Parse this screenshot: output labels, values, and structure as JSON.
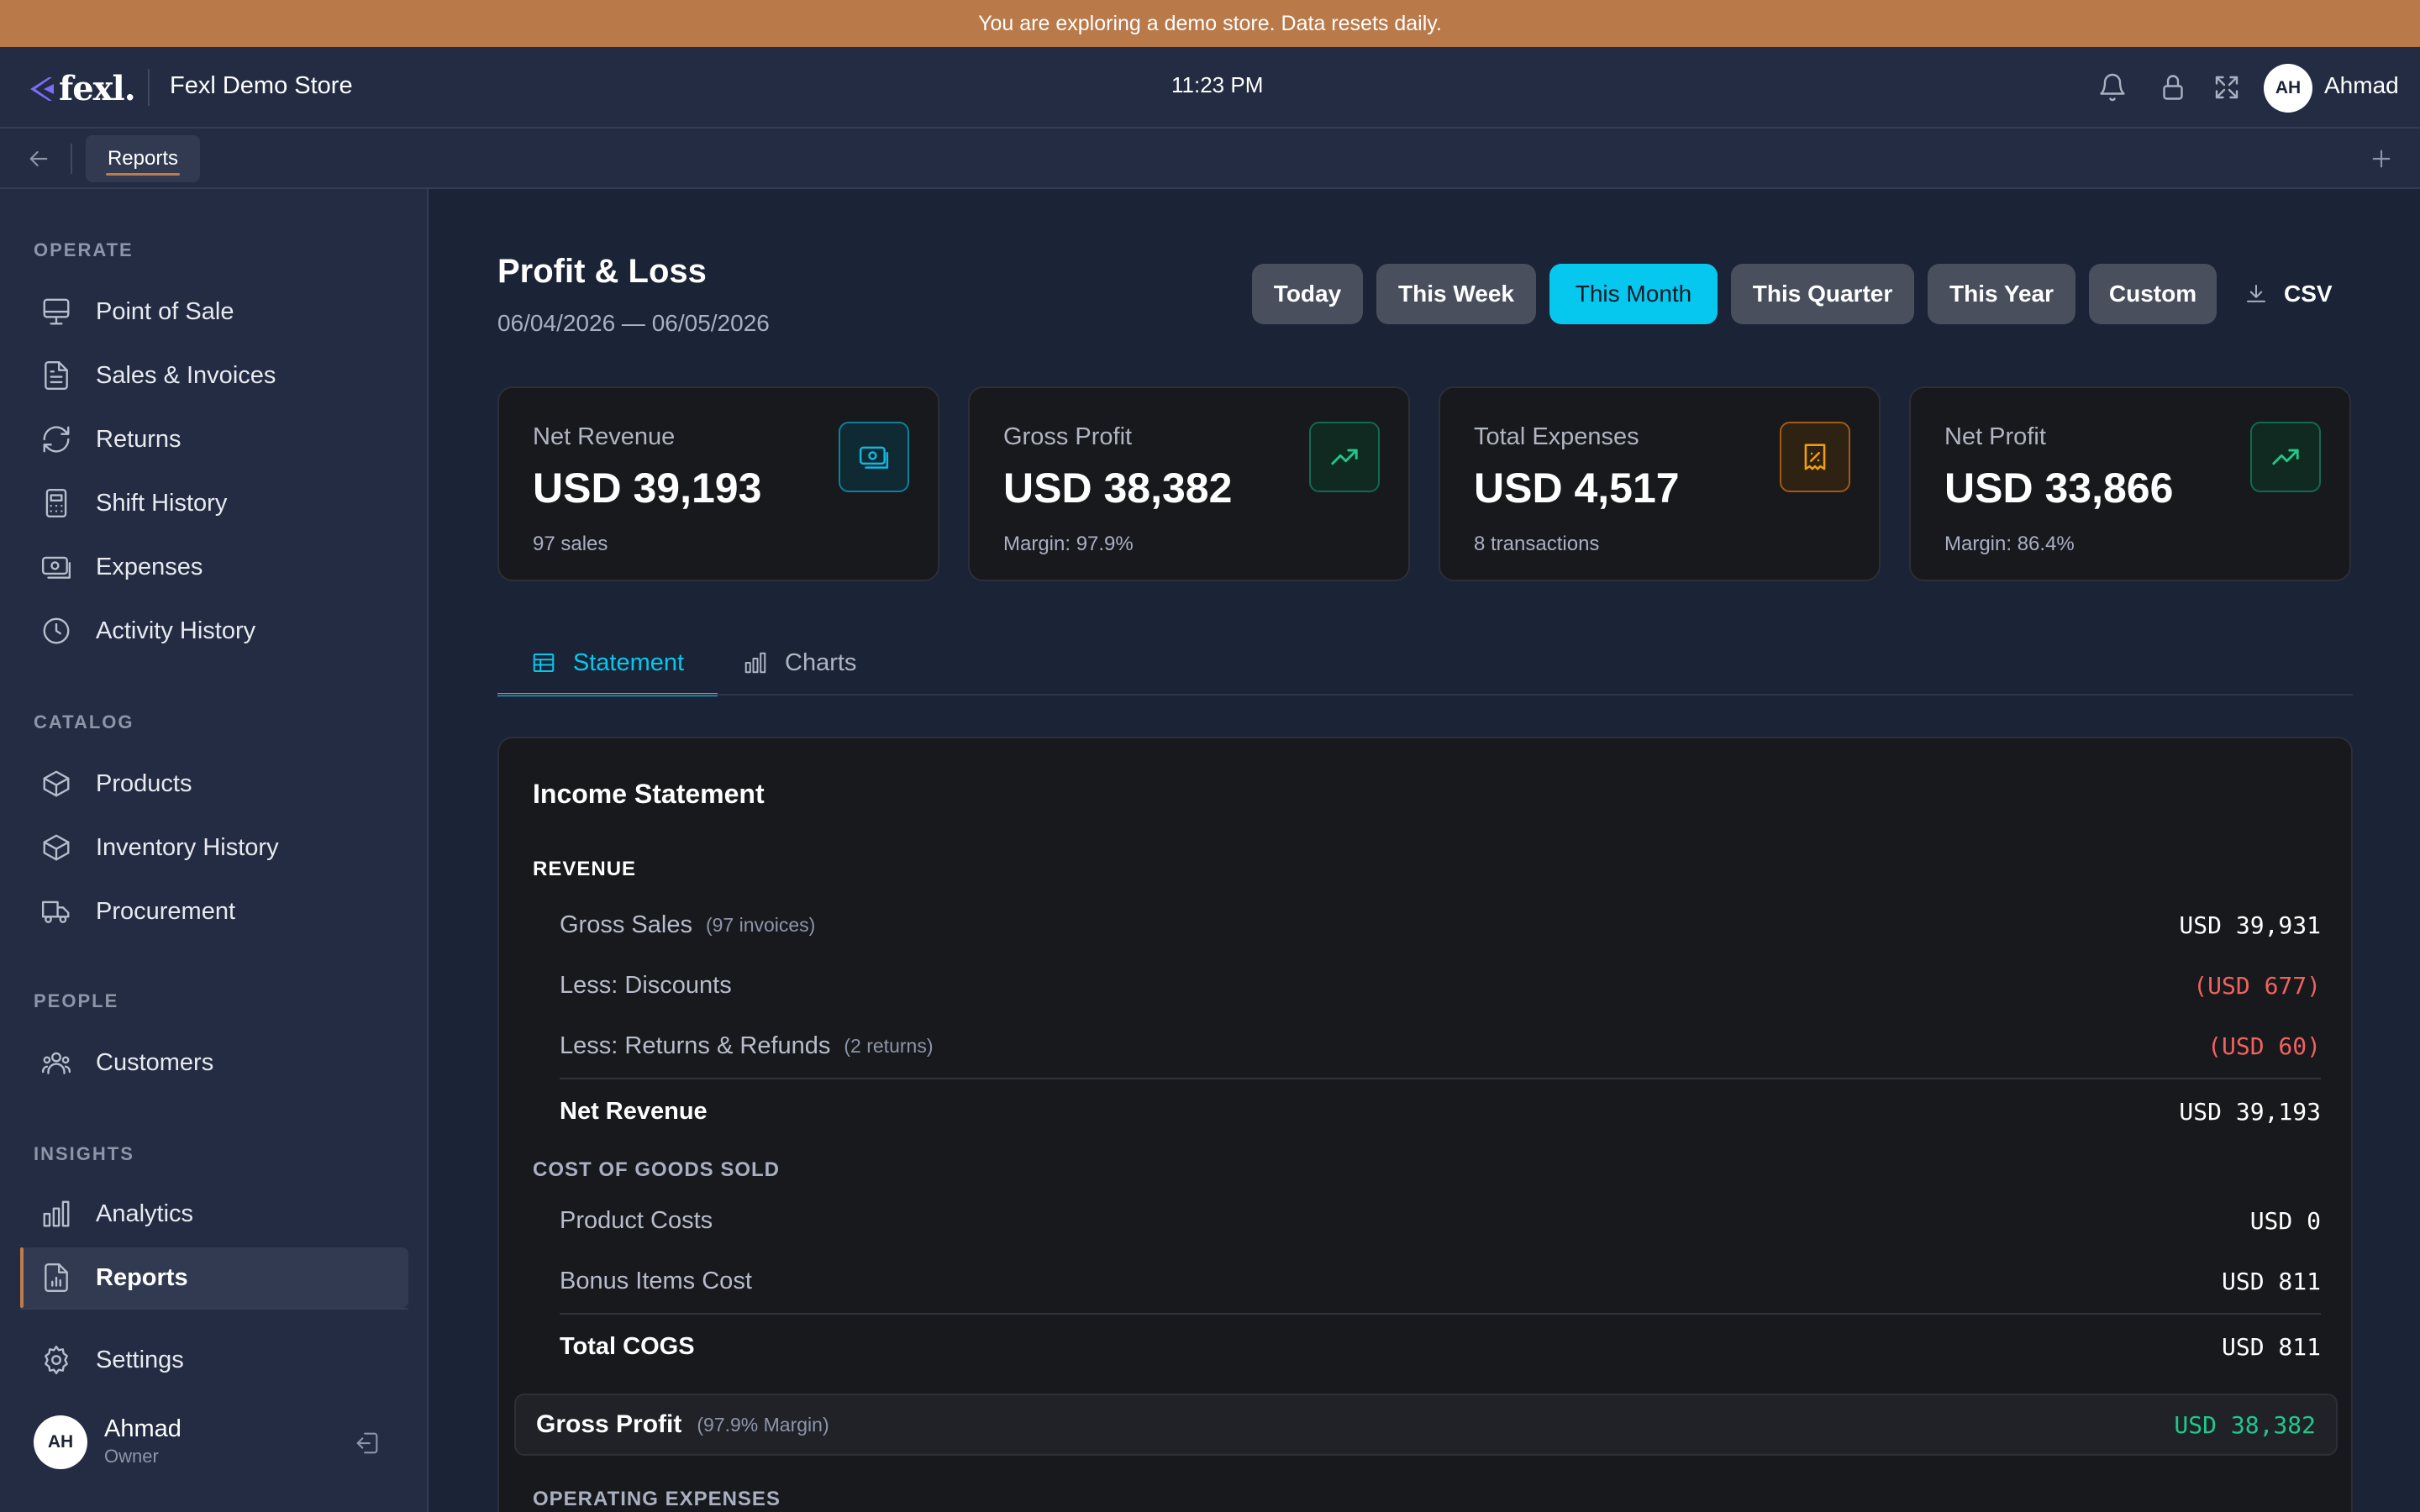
{
  "banner": {
    "text": "You are exploring a demo store. Data resets daily."
  },
  "header": {
    "logo_text": "fexl.",
    "store_name": "Fexl Demo Store",
    "time": "11:23 PM",
    "user_initials": "AH",
    "user_name": "Ahmad",
    "icons": [
      "bell-icon",
      "lock-icon",
      "fullscreen-icon"
    ]
  },
  "tabstrip": {
    "active_tab": "Reports"
  },
  "sidebar": {
    "sections": [
      {
        "label": "OPERATE",
        "items": [
          {
            "label": "Point of Sale",
            "icon": "monitor-icon"
          },
          {
            "label": "Sales & Invoices",
            "icon": "document-icon"
          },
          {
            "label": "Returns",
            "icon": "refresh-icon"
          },
          {
            "label": "Shift History",
            "icon": "calculator-icon"
          },
          {
            "label": "Expenses",
            "icon": "banknote-icon"
          },
          {
            "label": "Activity History",
            "icon": "clock-icon"
          }
        ]
      },
      {
        "label": "CATALOG",
        "items": [
          {
            "label": "Products",
            "icon": "box-icon"
          },
          {
            "label": "Inventory History",
            "icon": "box-icon"
          },
          {
            "label": "Procurement",
            "icon": "truck-icon"
          }
        ]
      },
      {
        "label": "PEOPLE",
        "items": [
          {
            "label": "Customers",
            "icon": "users-icon"
          }
        ]
      },
      {
        "label": "INSIGHTS",
        "items": [
          {
            "label": "Analytics",
            "icon": "bar-chart-icon"
          },
          {
            "label": "Reports",
            "icon": "report-icon",
            "active": true
          }
        ]
      }
    ],
    "settings_label": "Settings",
    "user": {
      "initials": "AH",
      "name": "Ahmad",
      "role": "Owner"
    }
  },
  "page": {
    "title": "Profit & Loss",
    "date_range": "06/04/2026 — 06/05/2026",
    "periods": [
      "Today",
      "This Week",
      "This Month",
      "This Quarter",
      "This Year",
      "Custom"
    ],
    "active_period": "This Month",
    "csv_label": "CSV"
  },
  "cards": [
    {
      "label": "Net Revenue",
      "value": "USD 39,193",
      "sub": "97 sales",
      "icon": "banknote-icon",
      "accent": "#0ea5c9"
    },
    {
      "label": "Gross Profit",
      "value": "USD 38,382",
      "sub": "Margin: 97.9%",
      "icon": "trending-up-icon",
      "accent": "#10b981"
    },
    {
      "label": "Total Expenses",
      "value": "USD 4,517",
      "sub": "8 transactions",
      "icon": "receipt-icon",
      "accent": "#f59e0b"
    },
    {
      "label": "Net Profit",
      "value": "USD 33,866",
      "sub": "Margin: 86.4%",
      "icon": "trending-up-icon",
      "accent": "#10b981"
    }
  ],
  "view_tabs": [
    {
      "label": "Statement",
      "icon": "table-icon",
      "active": true
    },
    {
      "label": "Charts",
      "icon": "bar-chart-icon",
      "active": false
    }
  ],
  "statement": {
    "title": "Income Statement",
    "revenue": {
      "heading": "REVENUE",
      "rows": [
        {
          "label": "Gross Sales",
          "note": "(97 invoices)",
          "value": "USD 39,931"
        },
        {
          "label": "Less: Discounts",
          "note": "",
          "value": "(USD 677)"
        },
        {
          "label": "Less: Returns & Refunds",
          "note": "(2 returns)",
          "value": "(USD 60)"
        }
      ],
      "total": {
        "label": "Net Revenue",
        "value": "USD 39,193"
      }
    },
    "cogs": {
      "heading": "COST OF GOODS SOLD",
      "rows": [
        {
          "label": "Product Costs",
          "value": "USD 0"
        },
        {
          "label": "Bonus Items Cost",
          "value": "USD 811"
        }
      ],
      "total": {
        "label": "Total COGS",
        "value": "USD 811"
      }
    },
    "gross_profit": {
      "label": "Gross Profit",
      "note": "(97.9% Margin)",
      "value": "USD 38,382"
    },
    "opex_heading": "OPERATING EXPENSES"
  },
  "colors": {
    "accent": "#06c8ee",
    "banner": "#b97949",
    "negative": "#f0625f",
    "positive": "#1fc98a"
  }
}
